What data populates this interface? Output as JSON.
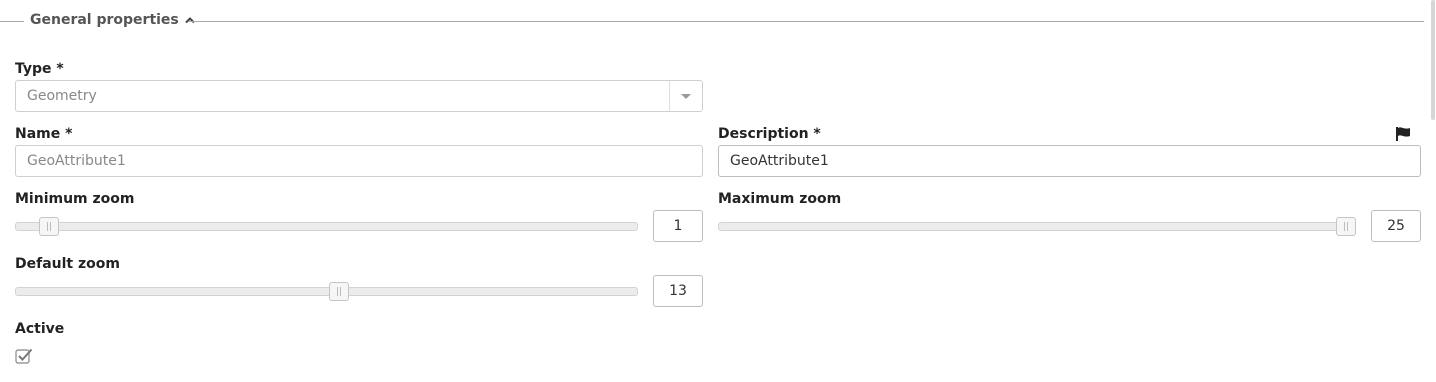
{
  "section": {
    "title": "General properties"
  },
  "type_field": {
    "label": "Type *",
    "value": "Geometry"
  },
  "name_field": {
    "label": "Name *",
    "value": "GeoAttribute1"
  },
  "description_field": {
    "label": "Description *",
    "value": "GeoAttribute1"
  },
  "min_zoom": {
    "label": "Minimum zoom",
    "value": "1",
    "slider_fraction": 0.0
  },
  "max_zoom": {
    "label": "Maximum zoom",
    "value": "25",
    "slider_fraction": 1.0
  },
  "default_zoom": {
    "label": "Default zoom",
    "value": "13",
    "slider_fraction": 0.5
  },
  "active": {
    "label": "Active",
    "checked": true
  },
  "icons": {
    "collapse": "chevron-up-icon",
    "translate": "flag-icon",
    "checkbox": "checkbox-checked-icon"
  }
}
